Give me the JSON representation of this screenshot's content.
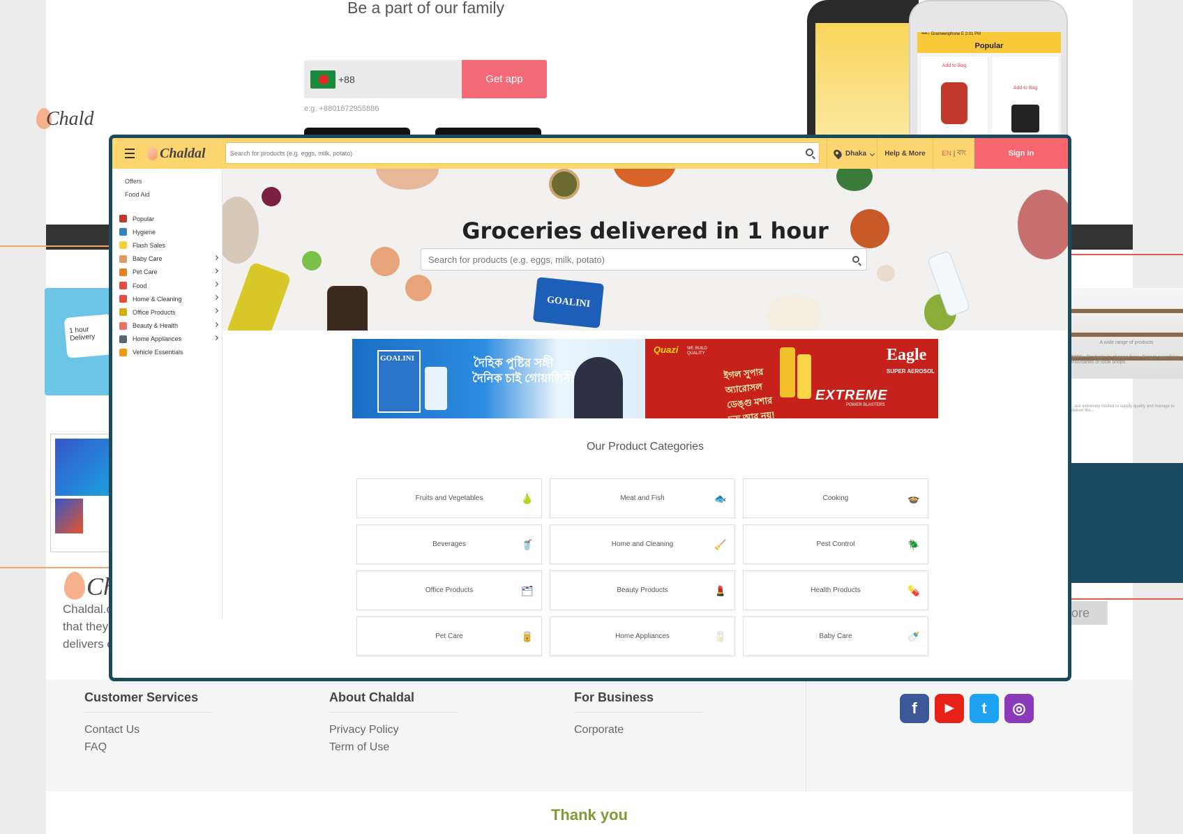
{
  "background": {
    "tagline": "Be a part of our family",
    "phone_prefix": "+88",
    "get_app_label": "Get app",
    "phone_example": "e.g. +8801672955886",
    "phone_mock": {
      "status": "••••○ Grameenphone  E   2:01 PM",
      "title": "Popular",
      "add_to_bag": "Add to Bag"
    },
    "left_promo": {
      "line1": "1 hour",
      "line2": "Delivery"
    },
    "left_logo": "Ch",
    "left_lines": [
      "Chaldal.c",
      "that they",
      "delivers e"
    ],
    "right_caption": "A wide range of products",
    "right_caption2": "5000+ Products to choose from. Forget searching thousands of local shops.",
    "right_caption3": "...are extremely trusted to supply quality and manage to deliver the...",
    "right_more": "ore"
  },
  "footer": {
    "customer_services": {
      "heading": "Customer Services",
      "links": [
        "Contact Us",
        "FAQ"
      ]
    },
    "about": {
      "heading": "About Chaldal",
      "links": [
        "Privacy Policy",
        "Term of Use"
      ]
    },
    "business": {
      "heading": "For Business",
      "links": [
        "Corporate"
      ]
    },
    "social": [
      {
        "name": "facebook-icon",
        "glyph": "f",
        "color": "#3b5998"
      },
      {
        "name": "youtube-icon",
        "glyph": "▶",
        "color": "#e62117"
      },
      {
        "name": "twitter-icon",
        "glyph": "t",
        "color": "#1da1f2"
      },
      {
        "name": "instagram-icon",
        "glyph": "◎",
        "color": "#8a3ab9"
      }
    ],
    "thank_you": "Thank you"
  },
  "app": {
    "logo_text": "Chaldal",
    "search_placeholder": "Search for products (e.g. eggs, milk, potato)",
    "location": "Dhaka",
    "help": "Help & More",
    "lang_en": "EN",
    "lang_sep": " | ",
    "lang_bn": "বাং",
    "sign_in": "Sign in",
    "sidebar_top": [
      "Offers",
      "Food Aid"
    ],
    "sidebar_items": [
      {
        "label": "Popular",
        "color": "#c0392b",
        "chevron": false
      },
      {
        "label": "Hygiene",
        "color": "#2e86c1",
        "chevron": false
      },
      {
        "label": "Flash Sales",
        "color": "#f4d03f",
        "chevron": false
      },
      {
        "label": "Baby Care",
        "color": "#e59866",
        "chevron": true
      },
      {
        "label": "Pet Care",
        "color": "#e67e22",
        "chevron": true
      },
      {
        "label": "Food",
        "color": "#e74c3c",
        "chevron": true
      },
      {
        "label": "Home & Cleaning",
        "color": "#e74c3c",
        "chevron": true
      },
      {
        "label": "Office Products",
        "color": "#d4ac0d",
        "chevron": true
      },
      {
        "label": "Beauty & Health",
        "color": "#ec7063",
        "chevron": true
      },
      {
        "label": "Home Appliances",
        "color": "#566573",
        "chevron": true
      },
      {
        "label": "Vehicle Essentials",
        "color": "#f39c12",
        "chevron": false
      }
    ],
    "hero_title": "Groceries delivered in 1 hour",
    "hero_search_placeholder": "Search for products (e.g. eggs, milk, potato)",
    "banner1": {
      "brand": "GOALINI",
      "line1": "দৈহিক পুষ্টির সঙ্গী",
      "line2": "দৈনিক চাই গোয়ালিনী"
    },
    "banner2": {
      "brand": "Quazi",
      "tagline": "WE BUILD QUALITY",
      "bn_text": "ইগল সুপার অ্যারোসল ডেঙ্গু মশার ভয় আর নয়!",
      "product": "Eagle",
      "product_sub": "SUPER AEROSOL",
      "extreme": "EXTREME",
      "extreme_sub": "POWER BLASTERS"
    },
    "categories_title": "Our Product Categories",
    "categories": [
      {
        "label": "Fruits and Vegetables",
        "icon": "fruit-icon",
        "glyph": "🍐",
        "color": "#e6c020"
      },
      {
        "label": "Meat and Fish",
        "icon": "fish-icon",
        "glyph": "🐟",
        "color": "#4a8fd0"
      },
      {
        "label": "Cooking",
        "icon": "cooking-pot-icon",
        "glyph": "🍲",
        "color": "#c06020"
      },
      {
        "label": "Beverages",
        "icon": "beverage-icon",
        "glyph": "🥤",
        "color": "#d83a2a"
      },
      {
        "label": "Home and Cleaning",
        "icon": "broom-icon",
        "glyph": "🧹",
        "color": "#e09030"
      },
      {
        "label": "Pest Control",
        "icon": "bug-icon",
        "glyph": "🪲",
        "color": "#2f6a2f"
      },
      {
        "label": "Office Products",
        "icon": "stapler-icon",
        "glyph": "🗂",
        "color": "#2a4a8a"
      },
      {
        "label": "Beauty Products",
        "icon": "cosmetics-icon",
        "glyph": "💄",
        "color": "#9a4ab0"
      },
      {
        "label": "Health Products",
        "icon": "medicine-icon",
        "glyph": "💊",
        "color": "#c03030"
      },
      {
        "label": "Pet Care",
        "icon": "pet-food-icon",
        "glyph": "🥫",
        "color": "#6a6a3a"
      },
      {
        "label": "Home Appliances",
        "icon": "blender-icon",
        "glyph": "🥛",
        "color": "#333333"
      },
      {
        "label": "Baby Care",
        "icon": "baby-bottle-icon",
        "glyph": "🍼",
        "color": "#7a5a3a"
      }
    ]
  }
}
